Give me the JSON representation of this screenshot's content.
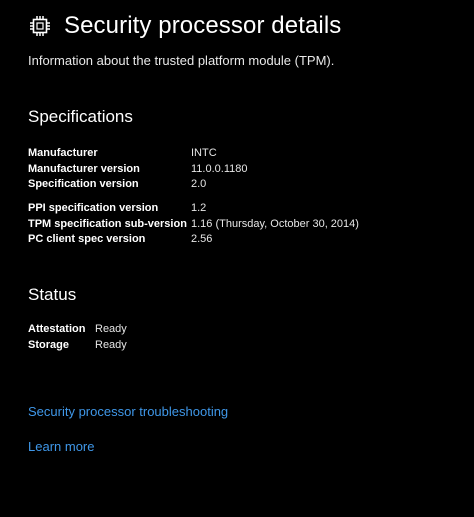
{
  "header": {
    "icon": "chip-icon",
    "title": "Security processor details",
    "subtitle": "Information about the trusted platform module (TPM)."
  },
  "specifications": {
    "title": "Specifications",
    "rows": [
      {
        "key": "Manufacturer",
        "value": "INTC"
      },
      {
        "key": "Manufacturer version",
        "value": "11.0.0.1180"
      },
      {
        "key": "Specification version",
        "value": "2.0"
      },
      {
        "key": "PPI specification version",
        "value": "1.2"
      },
      {
        "key": "TPM specification sub-version",
        "value": "1.16 (Thursday, October 30, 2014)"
      },
      {
        "key": "PC client spec version",
        "value": "2.56"
      }
    ]
  },
  "status": {
    "title": "Status",
    "rows": [
      {
        "key": "Attestation",
        "value": "Ready"
      },
      {
        "key": "Storage",
        "value": "Ready"
      }
    ]
  },
  "links": {
    "troubleshooting": "Security processor troubleshooting",
    "learn_more": "Learn more"
  },
  "colors": {
    "background": "#000000",
    "text": "#ffffff",
    "link": "#3f97e8"
  }
}
